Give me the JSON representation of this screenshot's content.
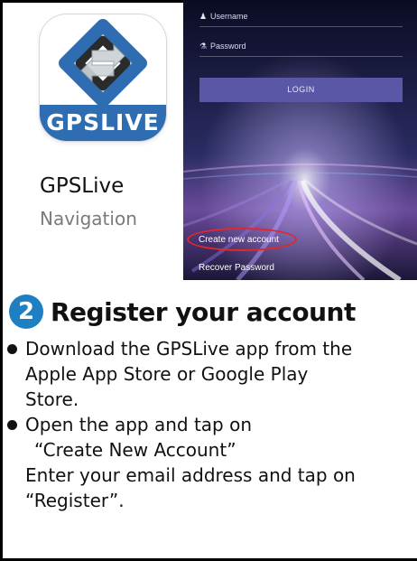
{
  "app": {
    "icon_label": "GPSLIVE",
    "name": "GPSLive",
    "category": "Navigation",
    "brand_color": "#2f6db2"
  },
  "login_screen": {
    "username_placeholder": "Username",
    "password_placeholder": "Password",
    "login_label": "LOGIN",
    "create_account_label": "Create new account",
    "recover_password_label": "Recover Password",
    "highlight_color": "#e3262d"
  },
  "step": {
    "number": "2",
    "title": "Register your account"
  },
  "instructions": {
    "bullet1": [
      "Download the GPSLive app from the",
      "Apple App Store or Google Play",
      "Store."
    ],
    "bullet2": [
      "Open the app and tap on",
      "“Create New Account”",
      "Enter your email address and tap on",
      "“Register”."
    ]
  }
}
